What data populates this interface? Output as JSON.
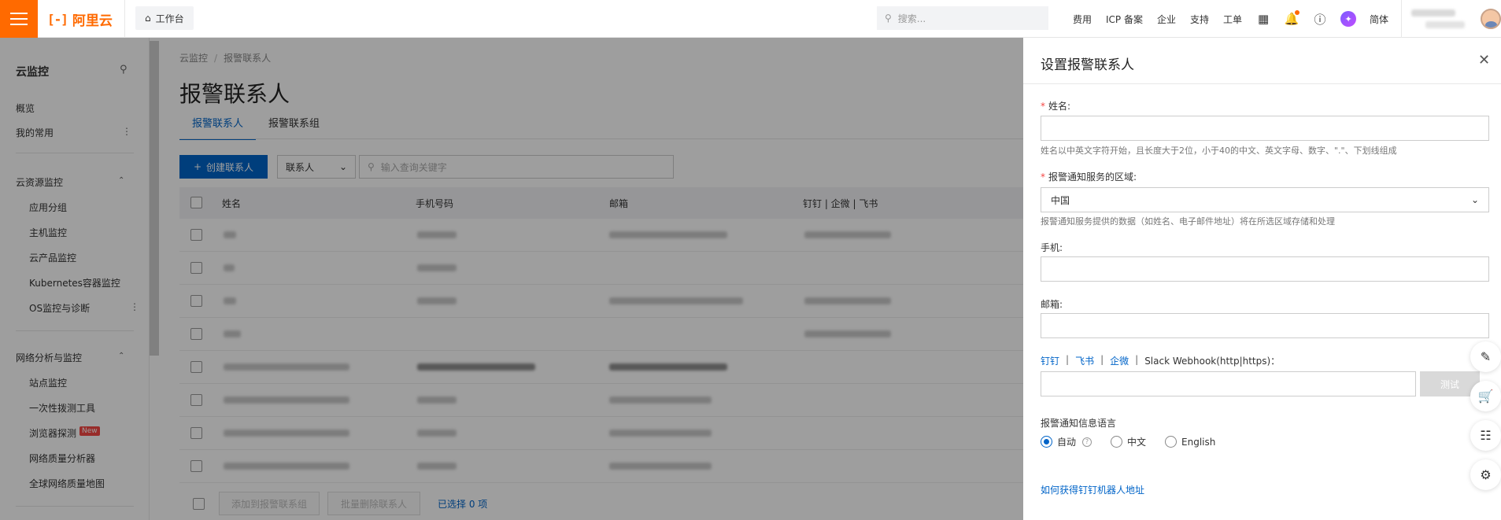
{
  "topbar": {
    "logo_mark": "[-]",
    "logo_text": "阿里云",
    "workbench": "工作台",
    "search_placeholder": "搜索...",
    "nav": [
      "费用",
      "ICP 备案",
      "企业",
      "支持",
      "工单"
    ],
    "lang": "简体",
    "icons": [
      "terminal-icon",
      "bell-icon",
      "help-icon",
      "ai-assistant-icon"
    ]
  },
  "sidebar": {
    "title": "云监控",
    "items": [
      {
        "label": "概览"
      },
      {
        "label": "我的常用"
      }
    ],
    "groups": [
      {
        "label": "云资源监控",
        "children": [
          "应用分组",
          "主机监控",
          "云产品监控",
          "Kubernetes容器监控",
          "OS监控与诊断"
        ]
      },
      {
        "label": "网络分析与监控",
        "children": [
          "站点监控",
          "一次性拨测工具",
          "浏览器探测",
          "网络质量分析器",
          "全球网络质量地图"
        ]
      }
    ],
    "new_badge": "New"
  },
  "main": {
    "breadcrumb": [
      "云监控",
      "报警联系人"
    ],
    "title": "报警联系人",
    "tabs": [
      "报警联系人",
      "报警联系组"
    ],
    "create_button": "创建联系人",
    "type_select": "联系人",
    "query_placeholder": "输入查询关键字",
    "columns": [
      "姓名",
      "手机号码",
      "邮箱",
      "钉钉 | 企微 | 飞书"
    ],
    "footer": {
      "add_to_group": "添加到报警联系组",
      "batch_delete": "批量删除联系人",
      "selected": "已选择 0 项"
    }
  },
  "drawer": {
    "title": "设置报警联系人",
    "name_label": "姓名:",
    "name_hint": "姓名以中英文字符开始，且长度大于2位，小于40的中文、英文字母、数字、\".\"、下划线组成",
    "region_label": "报警通知服务的区域:",
    "region_value": "中国",
    "region_hint": "报警通知服务提供的数据（如姓名、电子邮件地址）将在所选区域存储和处理",
    "phone_label": "手机:",
    "email_label": "邮箱:",
    "webhook_links": [
      "钉钉",
      "飞书",
      "企微"
    ],
    "webhook_label": "Slack Webhook(http|https)：",
    "test_button": "测试",
    "lang_label": "报警通知信息语言",
    "lang_options": [
      "自动",
      "中文",
      "English"
    ],
    "lang_selected": "自动",
    "robot_link": "如何获得钉钉机器人地址"
  },
  "colors": {
    "brand": "#ff6a00",
    "primary": "#0064c8",
    "required": "#f54745"
  }
}
